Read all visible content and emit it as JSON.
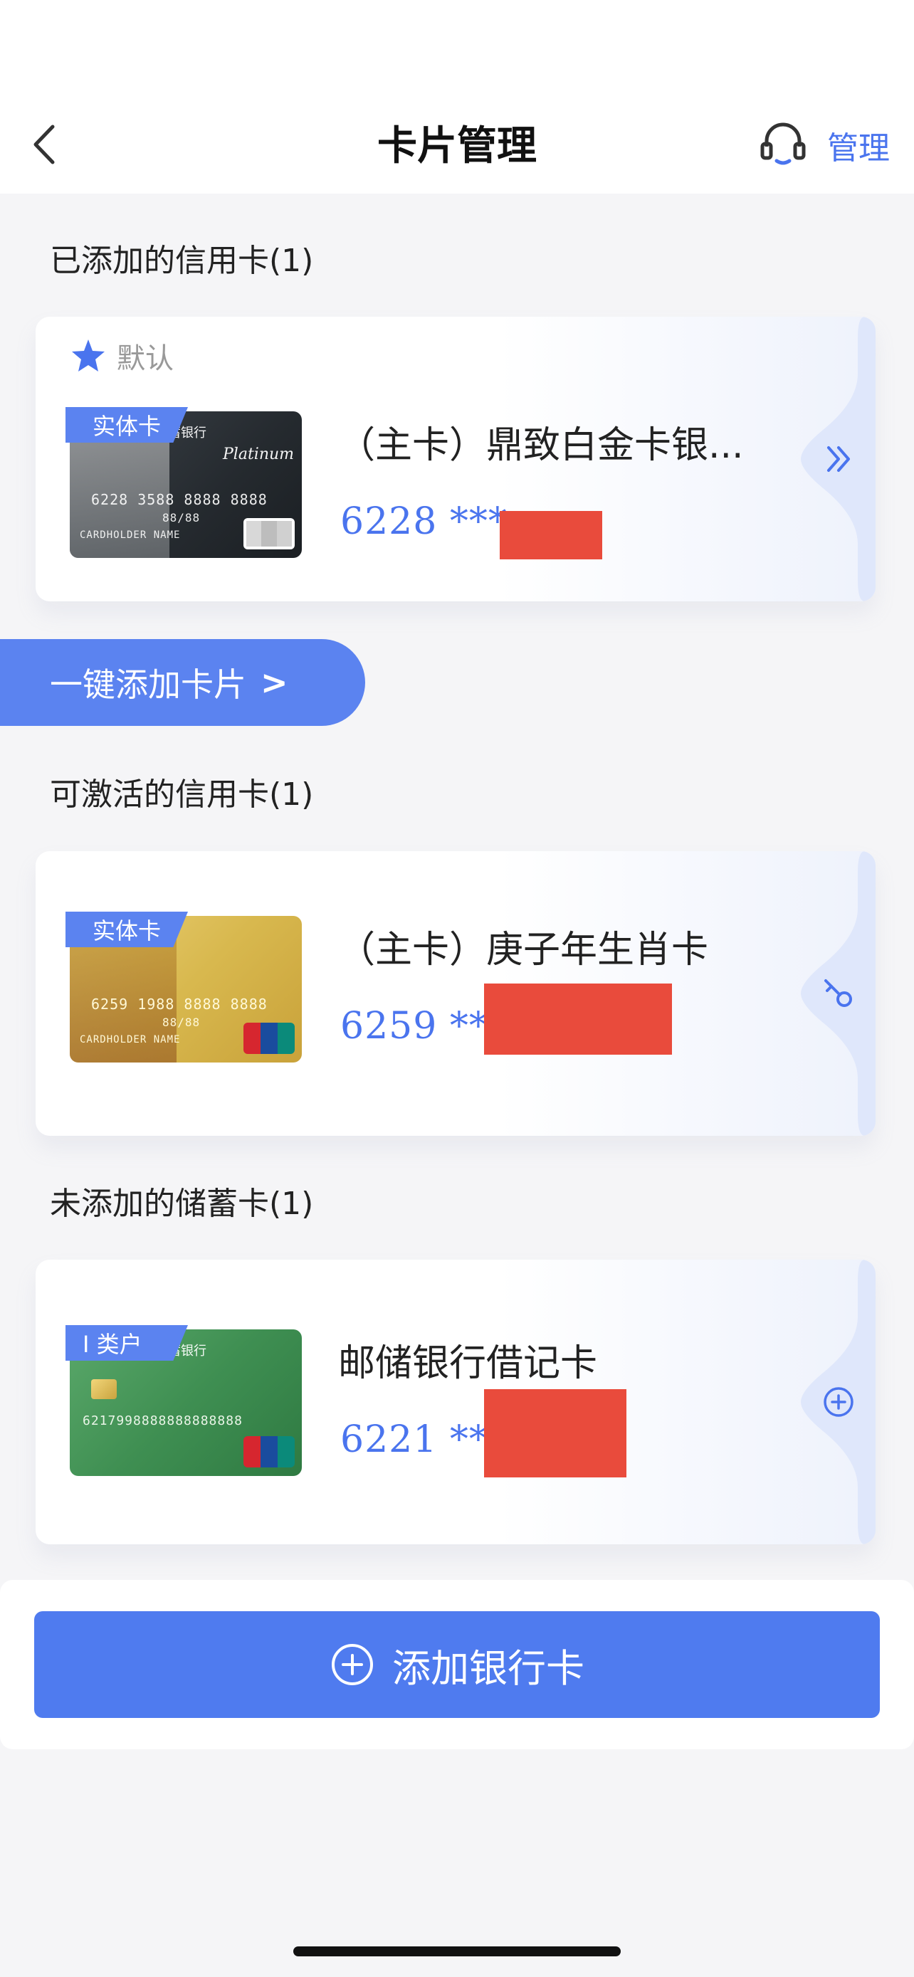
{
  "header": {
    "title": "卡片管理",
    "manage_label": "管理"
  },
  "sections": {
    "added_credit_title": "已添加的信用卡(1)",
    "activatable_credit_title": "可激活的信用卡(1)",
    "unadded_debit_title": "未添加的储蓄卡(1)"
  },
  "cards": [
    {
      "default_label": "默认",
      "badge": "实体卡",
      "name": "（主卡）鼎致白金卡银...",
      "number_prefix": "6228 ***",
      "thumb_bank": "储蓄银行",
      "thumb_number": "6228 3588 8888 8888",
      "thumb_extra": "88/88",
      "thumb_holder": "CARDHOLDER NAME",
      "thumb_brand": "Platinum",
      "side_icon": "double-chevron-right-icon"
    },
    {
      "badge": "实体卡",
      "name": "（主卡）庚子年生肖卡",
      "number_prefix": "6259 ***",
      "thumb_number": "6259 1988 8888 8888",
      "thumb_extra": "88/88",
      "thumb_holder": "CARDHOLDER NAME",
      "side_icon": "key-icon"
    },
    {
      "badge": "I 类户",
      "name": "邮储银行借记卡",
      "number_prefix": "6221 ***",
      "thumb_bank": "储蓄银行",
      "thumb_number": "6217998888888888888",
      "side_icon": "plus-circle-icon"
    }
  ],
  "quick_add": {
    "label": "一键添加卡片",
    "arrow": ">"
  },
  "bottom": {
    "add_bank_label": "添加银行卡"
  },
  "colors": {
    "accent": "#4f7bef",
    "redaction": "#e94b3c",
    "background": "#f5f5f7"
  }
}
